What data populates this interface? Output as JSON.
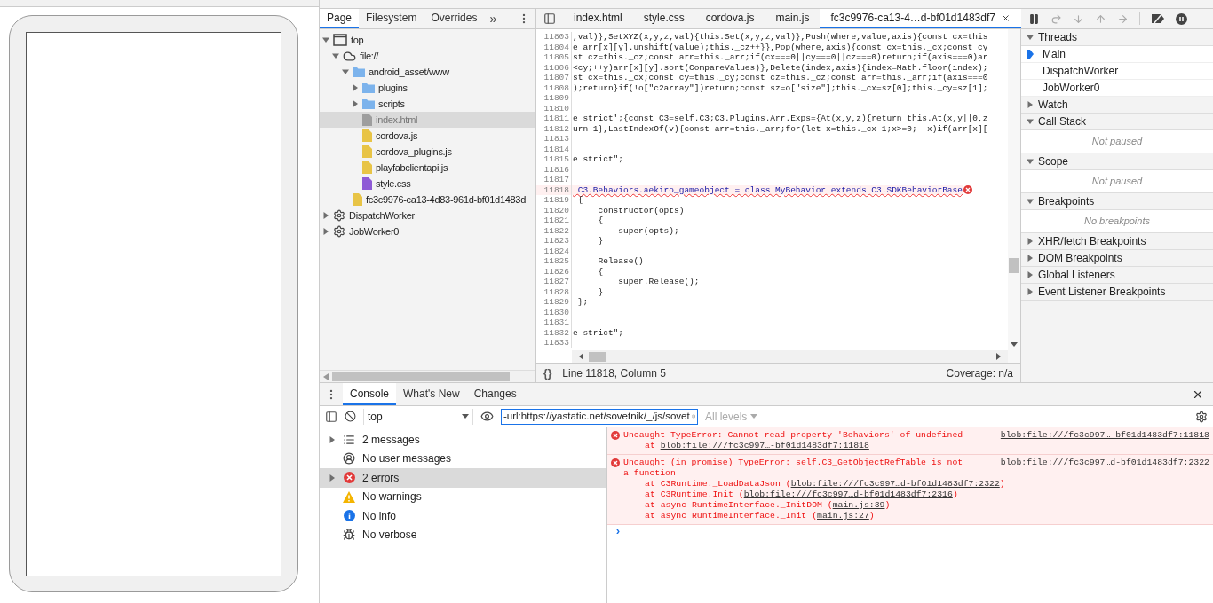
{
  "navigator": {
    "tabs": [
      {
        "label": "Page",
        "selected": true
      },
      {
        "label": "Filesystem",
        "selected": false
      },
      {
        "label": "Overrides",
        "selected": false
      }
    ],
    "more": "»",
    "tree": [
      {
        "label": "top",
        "kind": "frame",
        "expanded": true,
        "selected": false,
        "children": [
          {
            "label": "file://",
            "kind": "cloud",
            "expanded": true,
            "selected": false,
            "children": [
              {
                "label": "android_asset/www",
                "kind": "folder",
                "expanded": true,
                "selected": false,
                "children": [
                  {
                    "label": "plugins",
                    "kind": "folder",
                    "expanded": false,
                    "selected": false
                  },
                  {
                    "label": "scripts",
                    "kind": "folder",
                    "expanded": false,
                    "selected": false
                  },
                  {
                    "label": "index.html",
                    "kind": "html",
                    "selected": true
                  },
                  {
                    "label": "cordova.js",
                    "kind": "js",
                    "selected": false
                  },
                  {
                    "label": "cordova_plugins.js",
                    "kind": "js",
                    "selected": false
                  },
                  {
                    "label": "playfabclientapi.js",
                    "kind": "js",
                    "selected": false
                  },
                  {
                    "label": "style.css",
                    "kind": "css",
                    "selected": false
                  }
                ]
              },
              {
                "label": "fc3c9976-ca13-4d83-961d-bf01d1483d",
                "kind": "js",
                "selected": false
              }
            ]
          }
        ]
      },
      {
        "label": "DispatchWorker",
        "kind": "gear",
        "expanded": false,
        "selected": false
      },
      {
        "label": "JobWorker0",
        "kind": "gear",
        "expanded": false,
        "selected": false
      }
    ]
  },
  "editor": {
    "tabs": [
      {
        "label": "index.html",
        "selected": false,
        "closable": false
      },
      {
        "label": "style.css",
        "selected": false,
        "closable": false
      },
      {
        "label": "cordova.js",
        "selected": false,
        "closable": false
      },
      {
        "label": "main.js",
        "selected": false,
        "closable": false
      },
      {
        "label": "fc3c9976-ca13-4…d-bf01d1483df7",
        "selected": true,
        "closable": true
      }
    ],
    "lines": [
      {
        "number": "11803",
        "text": ",val)},SetXYZ(x,y,z,val){this.Set(x,y,z,val)},Push(where,value,axis){const cx=this",
        "error": false
      },
      {
        "number": "11804",
        "text": "e arr[x][y].unshift(value);this._cz++}},Pop(where,axis){const cx=this._cx;const cy",
        "error": false
      },
      {
        "number": "11805",
        "text": "st cz=this._cz;const arr=this._arr;if(cx===0||cy===0||cz===0)return;if(axis===0)ar",
        "error": false
      },
      {
        "number": "11806",
        "text": "<cy;++y)arr[x][y].sort(CompareValues)},Delete(index,axis){index=Math.floor(index);",
        "error": false
      },
      {
        "number": "11807",
        "text": "st cx=this._cx;const cy=this._cy;const cz=this._cz;const arr=this._arr;if(axis===0",
        "error": false
      },
      {
        "number": "11808",
        "text": ");return}if(!o[\"c2array\"])return;const sz=o[\"size\"];this._cx=sz[0];this._cy=sz[1];",
        "error": false
      },
      {
        "number": "11809",
        "error": false
      },
      {
        "number": "11810",
        "error": false
      },
      {
        "number": "11811",
        "text": "e strict';{const C3=self.C3;C3.Plugins.Arr.Exps={At(x,y,z){return this.At(x,y||0,z",
        "error": false
      },
      {
        "number": "11812",
        "text": "urn-1},LastIndexOf(v){const arr=this._arr;for(let x=this._cx-1;x>=0;--x)if(arr[x][",
        "error": false
      },
      {
        "number": "11813",
        "error": false
      },
      {
        "number": "11814",
        "error": false
      },
      {
        "number": "11815",
        "text": "e strict\";",
        "error": false
      },
      {
        "number": "11816",
        "error": false
      },
      {
        "number": "11817",
        "error": false
      },
      {
        "number": "11818",
        "text": " C3.Behaviors.aekiro_gameobject = class MyBehavior extends C3.SDKBehaviorBase",
        "error": true
      },
      {
        "number": "11819",
        "text": " {",
        "error": false
      },
      {
        "number": "11820",
        "text": "     constructor(opts)",
        "error": false
      },
      {
        "number": "11821",
        "text": "     {",
        "error": false
      },
      {
        "number": "11822",
        "text": "         super(opts);",
        "error": false
      },
      {
        "number": "11823",
        "text": "     }",
        "error": false
      },
      {
        "number": "11824",
        "error": false
      },
      {
        "number": "11825",
        "text": "     Release()",
        "error": false
      },
      {
        "number": "11826",
        "text": "     {",
        "error": false
      },
      {
        "number": "11827",
        "text": "         super.Release();",
        "error": false
      },
      {
        "number": "11828",
        "text": "     }",
        "error": false
      },
      {
        "number": "11829",
        "text": " };",
        "error": false
      },
      {
        "number": "11830",
        "error": false
      },
      {
        "number": "11831",
        "error": false
      },
      {
        "number": "11832",
        "text": "e strict\";",
        "error": false
      },
      {
        "number": "11833",
        "error": false
      }
    ],
    "status": {
      "pretty_print": "{}",
      "position": "Line 11818, Column 5",
      "coverage": "Coverage: n/a"
    }
  },
  "debugger": {
    "sections": [
      {
        "title": "Threads",
        "expanded": true,
        "threads": [
          {
            "label": "Main",
            "selected": true
          },
          {
            "label": "DispatchWorker",
            "selected": false
          },
          {
            "label": "JobWorker0",
            "selected": false
          }
        ]
      },
      {
        "title": "Watch",
        "expanded": false
      },
      {
        "title": "Call Stack",
        "expanded": true,
        "empty_text": "Not paused"
      },
      {
        "title": "Scope",
        "expanded": true,
        "empty_text": "Not paused"
      },
      {
        "title": "Breakpoints",
        "expanded": true,
        "empty_text": "No breakpoints"
      },
      {
        "title": "XHR/fetch Breakpoints",
        "expanded": false
      },
      {
        "title": "DOM Breakpoints",
        "expanded": false
      },
      {
        "title": "Global Listeners",
        "expanded": false
      },
      {
        "title": "Event Listener Breakpoints",
        "expanded": false
      }
    ]
  },
  "drawer": {
    "tabs": [
      {
        "label": "Console",
        "selected": true
      },
      {
        "label": "What's New",
        "selected": false
      },
      {
        "label": "Changes",
        "selected": false
      }
    ],
    "context": "top",
    "filter": {
      "value": "-url:https://yastatic.net/sovetnik/_/js/sovet"
    },
    "levels": {
      "label": "All levels",
      "disabled": true
    },
    "sidebar": [
      {
        "label": "2 messages",
        "kind": "list",
        "expandable": true,
        "selected": false
      },
      {
        "label": "No user messages",
        "kind": "user",
        "expandable": false,
        "selected": false
      },
      {
        "label": "2 errors",
        "kind": "error",
        "expandable": true,
        "selected": true
      },
      {
        "label": "No warnings",
        "kind": "warning",
        "expandable": false,
        "selected": false
      },
      {
        "label": "No info",
        "kind": "info",
        "expandable": false,
        "selected": false
      },
      {
        "label": "No verbose",
        "kind": "verbose",
        "expandable": false,
        "selected": false
      }
    ],
    "messages": [
      {
        "lines": [
          "Uncaught TypeError: Cannot read property 'Behaviors' of undefined"
        ],
        "source": "blob:file:///fc3c997…-bf01d1483df7:11818",
        "stack": [
          {
            "before": "at ",
            "link": "blob:file:///fc3c997…-bf01d1483df7:11818"
          }
        ]
      },
      {
        "lines": [
          "Uncaught (in promise) TypeError: self.C3_GetObjectRefTable is not",
          "a function"
        ],
        "source": "blob:file:///fc3c997…d-bf01d1483df7:2322",
        "stack": [
          {
            "before": "at C3Runtime._LoadDataJson (",
            "link": "blob:file:///fc3c997…d-bf01d1483df7:2322",
            "after": ")"
          },
          {
            "before": "at C3Runtime.Init (",
            "link": "blob:file:///fc3c997…d-bf01d1483df7:2316",
            "after": ")"
          },
          {
            "before": "at async RuntimeInterface._InitDOM (",
            "link": "main.js:39",
            "after": ")"
          },
          {
            "before": "at async RuntimeInterface._Init (",
            "link": "main.js:27",
            "after": ")"
          }
        ]
      }
    ],
    "prompt": "›"
  }
}
